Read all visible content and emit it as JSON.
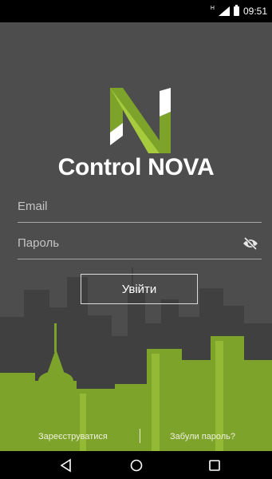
{
  "status_bar": {
    "time": "09:51",
    "signal_label": "H"
  },
  "app": {
    "title": "Control NOVA",
    "logo_letter": "N"
  },
  "form": {
    "email": {
      "placeholder": "Email",
      "value": ""
    },
    "password": {
      "placeholder": "Пароль",
      "value": ""
    },
    "login_label": "Увійти"
  },
  "links": {
    "register": "Зареєструватися",
    "forgot_password": "Забули пароль?"
  },
  "colors": {
    "background": "#4d4d4d",
    "accent_green": "#7ea32a",
    "accent_green_light": "#a6cc3d",
    "city_dark": "#3a3a3a"
  },
  "icons": [
    "eye-off-icon",
    "back-icon",
    "home-icon",
    "recents-icon",
    "signal-icon",
    "battery-icon"
  ]
}
